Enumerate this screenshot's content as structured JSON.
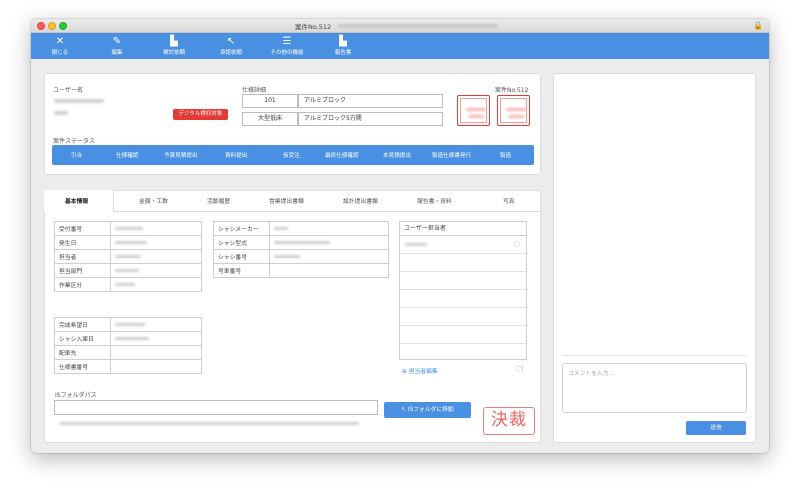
{
  "window": {
    "title": "案件No.512"
  },
  "toolbar": {
    "buttons": [
      {
        "icon": "✕",
        "label": "閉じる"
      },
      {
        "icon": "✎",
        "label": "編集"
      },
      {
        "icon": "▙",
        "label": "検討依頼"
      },
      {
        "icon": "↖",
        "label": "承認依頼"
      },
      {
        "icon": "☰",
        "label": "その他の機能"
      },
      {
        "icon": "▙",
        "label": "報告書"
      }
    ]
  },
  "header": {
    "user_name_label": "ユーザー名",
    "digital_button": "デジタル検収対象",
    "spec_detail_label": "仕様詳細",
    "spec_row1_code": "101",
    "spec_row1_name": "アルミブロック",
    "spec_row2_code": "大型低床",
    "spec_row2_name": "アルミブロック5方開",
    "case_no": "案件No.512",
    "status_label": "案件ステータス"
  },
  "status_steps": [
    "引合",
    "仕様確認",
    "予算見積提出",
    "資料提出",
    "仮受注",
    "最終仕様確認",
    "本見積提出",
    "製造仕様書発行",
    "製造"
  ],
  "tabs": [
    "基本情報",
    "金額・工数",
    "活動履歴",
    "営業提出書類",
    "設計提出書類",
    "報告書・資料",
    "写真"
  ],
  "left_table_1": [
    "受付番号",
    "発生日",
    "担当者",
    "担当部門",
    "作業区分"
  ],
  "left_table_2": [
    "完成希望日",
    "シャシ入庫日",
    "配車先",
    "仕様書番号"
  ],
  "mid_table": [
    "シャシメーカー",
    "シャシ型式",
    "シャシ番号",
    "号車番号"
  ],
  "assignee": {
    "header": "ユーザー担当者",
    "edit_link": "担当者編集"
  },
  "is_folder": {
    "label": "ISフォルダパス",
    "move_button": "ISフォルダに移動"
  },
  "stamp_kessai": "決裁",
  "comment": {
    "placeholder": "コメントを入力...",
    "send_button": "送信"
  },
  "colors": {
    "accent": "#4a90e2",
    "danger": "#e53935"
  }
}
